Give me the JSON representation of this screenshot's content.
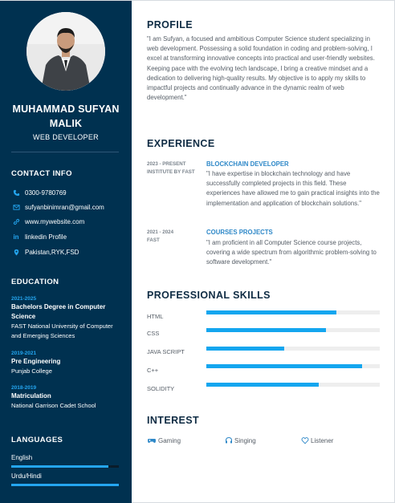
{
  "sidebar": {
    "name": "MUHAMMAD SUFYAN MALIK",
    "role": "WEB DEVELOPER",
    "contact_heading": "CONTACT INFO",
    "contacts": [
      {
        "icon": "phone-icon",
        "text": "0300-9780769"
      },
      {
        "icon": "mail-icon",
        "text": "sufyanbinimran@gmail.com"
      },
      {
        "icon": "link-icon",
        "text": "www.mywebsite.com"
      },
      {
        "icon": "linkedin-icon",
        "text": "linkedin Profile"
      },
      {
        "icon": "location-pin-icon",
        "text": "Pakistan,RYK,FSD"
      }
    ],
    "education_heading": "EDUCATION",
    "education": [
      {
        "years": "2021-2025",
        "degree": "Bachelors Degree in Computer Science",
        "school": "FAST National University of Computer and Emerging Sciences"
      },
      {
        "years": "2019-2021",
        "degree": "Pre Engineering",
        "school": "Punjab College"
      },
      {
        "years": "2018-2019",
        "degree": "Matriculation",
        "school": "National Garrison Cadet School"
      }
    ],
    "languages_heading": "LANGUAGES",
    "languages": [
      {
        "name": "English",
        "level": 0.9
      },
      {
        "name": "Urdu/Hindi",
        "level": 1.0
      }
    ]
  },
  "profile": {
    "heading": "PROFILE",
    "text": "\"I am Sufyan, a focused and ambitious Computer Science student specializing in web development. Possessing a solid foundation in coding and problem-solving, I excel at transforming innovative concepts into practical and user-friendly websites. Keeping pace with the evolving tech landscape, I bring a creative mindset and a dedication to delivering high-quality results. My objective is to apply my skills to impactful projects and continually advance in the dynamic realm of web development.\""
  },
  "experience": {
    "heading": "EXPERIENCE",
    "items": [
      {
        "date": "2023 - PRESENT",
        "place": "INSTITUTE BY FAST",
        "title": "BLOCKCHAIN DEVELOPER",
        "desc": "\"I have expertise in blockchain technology and have successfully completed projects in this field. These experiences have allowed me to gain practical insights into the implementation and application of blockchain solutions.\""
      },
      {
        "date": "2021 - 2024",
        "place": "FAST",
        "title": "COURSES PROJECTS",
        "desc": "\"I am proficient in all Computer Science course projects, covering a wide spectrum from algorithmic problem-solving to software development.\""
      }
    ]
  },
  "skills": {
    "heading": "PROFESSIONAL SKILLS",
    "items": [
      {
        "name": "HTML",
        "level": 0.75
      },
      {
        "name": "CSS",
        "level": 0.69
      },
      {
        "name": "JAVA SCRIPT",
        "level": 0.45
      },
      {
        "name": "C++",
        "level": 0.9
      },
      {
        "name": "SOLIDITY",
        "level": 0.65
      }
    ]
  },
  "interest": {
    "heading": "INTEREST",
    "items": [
      {
        "icon": "gamepad-icon",
        "label": "Gaming"
      },
      {
        "icon": "headphones-icon",
        "label": "Singing"
      },
      {
        "icon": "heart-icon",
        "label": "Listener"
      }
    ]
  },
  "colors": {
    "sidebar_bg": "#003150",
    "accent": "#24a6f0",
    "heading": "#0f2c44",
    "body_text": "#555d66",
    "skill_track": "#eeeeee"
  }
}
